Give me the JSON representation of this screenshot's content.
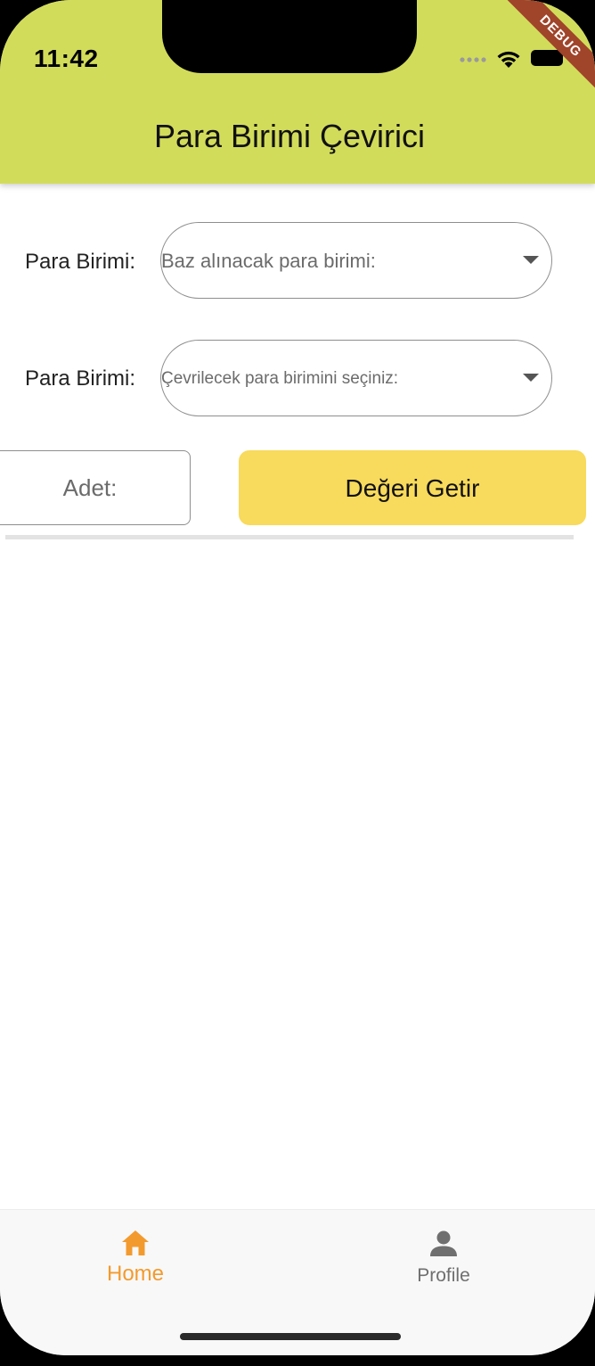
{
  "status_bar": {
    "time": "11:42",
    "debug_label": "DEBUG"
  },
  "app_bar": {
    "title": "Para Birimi Çevirici",
    "color": "#d2dc5b"
  },
  "form": {
    "base_currency": {
      "label": "Para Birimi:",
      "hint": "Baz alınacak para birimi:"
    },
    "target_currency": {
      "label": "Para Birimi:",
      "hint": "Çevrilecek para birimini seçiniz:"
    },
    "amount": {
      "placeholder": "Adet:"
    },
    "fetch_button": {
      "label": "Değeri Getir",
      "color": "#f8da5c"
    }
  },
  "bottom_nav": {
    "items": [
      {
        "label": "Home",
        "icon": "home-icon",
        "active": true,
        "color": "#f39a2e"
      },
      {
        "label": "Profile",
        "icon": "person-icon",
        "active": false,
        "color": "#6f6f6f"
      }
    ]
  }
}
